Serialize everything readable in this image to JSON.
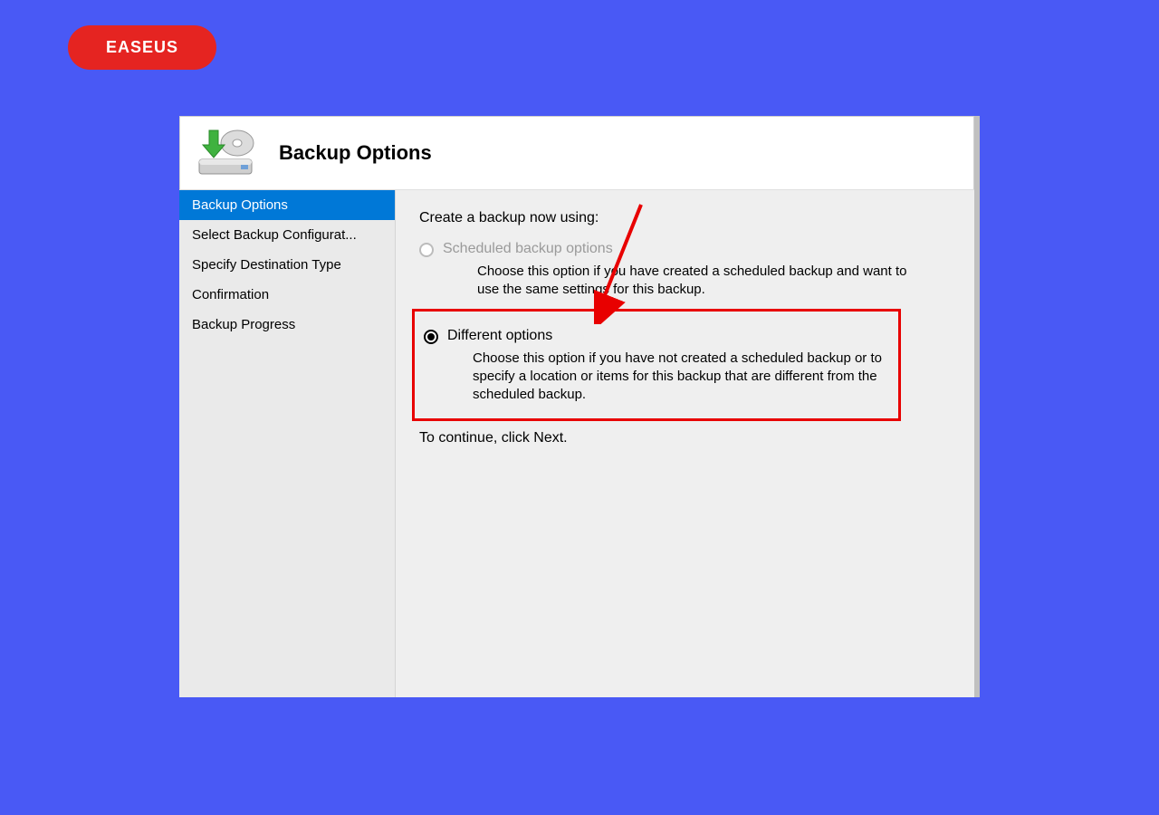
{
  "badge": {
    "label": "EASEUS"
  },
  "window": {
    "title": "Backup Options"
  },
  "sidebar": {
    "items": [
      {
        "label": "Backup Options",
        "selected": true
      },
      {
        "label": "Select Backup Configurat...",
        "selected": false
      },
      {
        "label": "Specify Destination Type",
        "selected": false
      },
      {
        "label": "Confirmation",
        "selected": false
      },
      {
        "label": "Backup Progress",
        "selected": false
      }
    ]
  },
  "content": {
    "prompt": "Create a backup now using:",
    "option1": {
      "label": "Scheduled backup options",
      "desc": "Choose this option if you have created a scheduled backup and want to use the same settings for this backup."
    },
    "option2": {
      "label": "Different options",
      "desc": "Choose this option if you have not created a scheduled backup or to specify a location or items for this backup that are different from the scheduled backup."
    },
    "continue": "To continue, click Next."
  }
}
